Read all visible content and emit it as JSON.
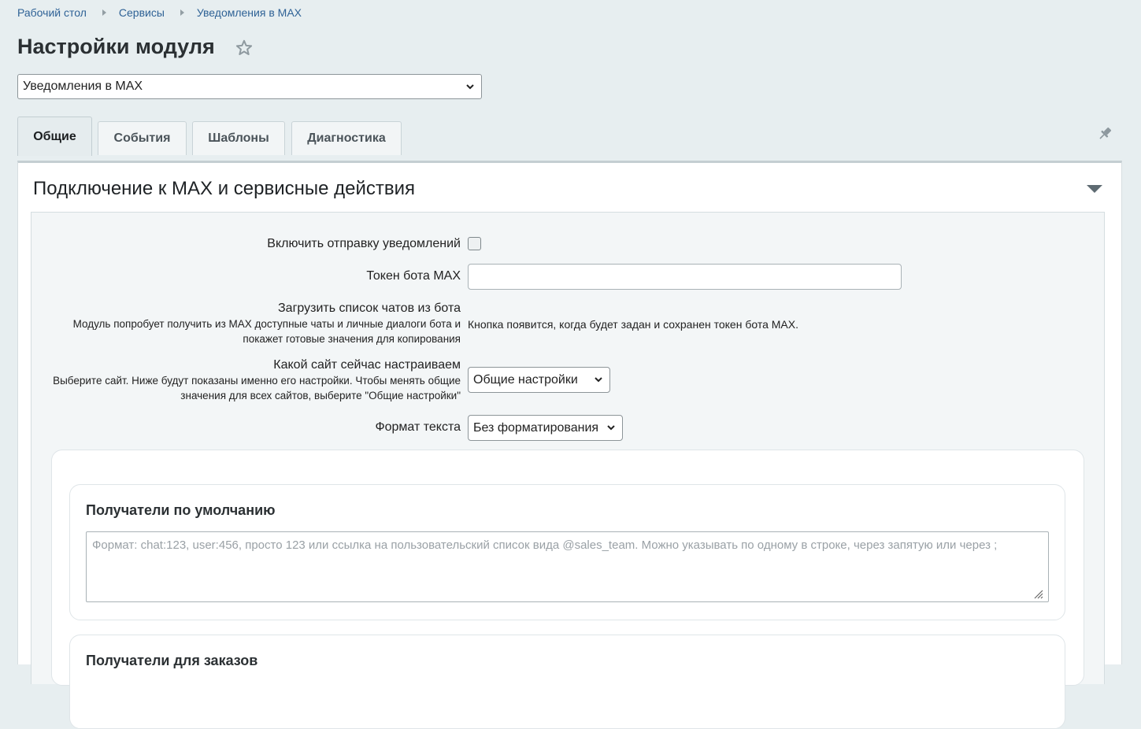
{
  "breadcrumbs": {
    "items": [
      "Рабочий стол",
      "Сервисы",
      "Уведомления в MAX"
    ]
  },
  "page": {
    "title": "Настройки модуля",
    "module_select_value": "Уведомления в MAX"
  },
  "tabs": [
    "Общие",
    "События",
    "Шаблоны",
    "Диагностика"
  ],
  "icons": {
    "favorite": "star-icon",
    "pin": "pin-icon",
    "collapse": "triangle-down-icon",
    "dropdown": "chevron-down-icon"
  },
  "section": {
    "title": "Подключение к MAX и сервисные действия",
    "enable_label": "Включить отправку уведомлений",
    "token_label": "Токен бота MAX",
    "token_value": "",
    "load_chats_label": "Загрузить список чатов из бота",
    "load_chats_hint": "Модуль попробует получить из MAX доступные чаты и личные диалоги бота и покажет готовые значения для копирования",
    "load_chats_note": "Кнопка появится, когда будет задан и сохранен токен бота MAX.",
    "site_label": "Какой сайт сейчас настраиваем",
    "site_hint": "Выберите сайт. Ниже будут показаны именно его настройки. Чтобы менять общие значения для всех сайтов, выберите \"Общие настройки\"",
    "site_value": "Общие настройки",
    "format_label": "Формат текста",
    "format_value": "Без форматирования"
  },
  "recipients": {
    "default_title": "Получатели по умолчанию",
    "default_placeholder": "Формат: chat:123, user:456, просто 123 или ссылка на пользовательский список вида @sales_team. Можно указывать по одному в строке, через запятую или через ;",
    "orders_title": "Получатели для заказов"
  },
  "colors": {
    "background": "#e7eef0",
    "link": "#2f6296",
    "panel": "#ffffff",
    "section_body": "#f3f6f7"
  }
}
